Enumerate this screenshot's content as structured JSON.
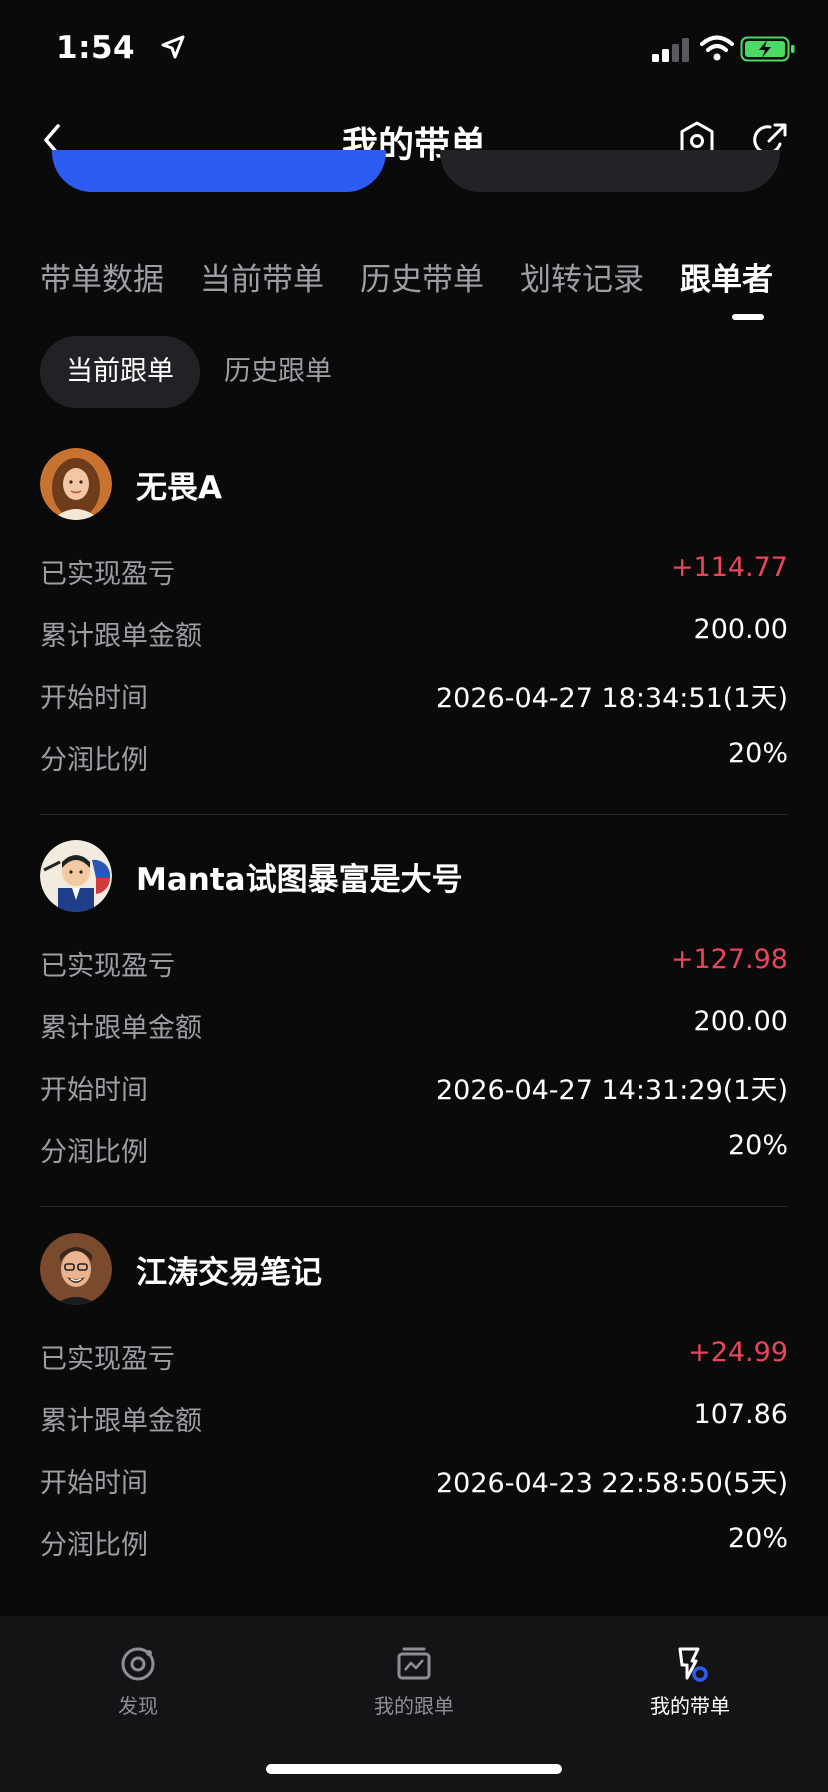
{
  "status_bar": {
    "time": "1:54"
  },
  "header": {
    "title": "我的带单"
  },
  "tabs": [
    {
      "label": "带单数据"
    },
    {
      "label": "当前带单"
    },
    {
      "label": "历史带单"
    },
    {
      "label": "划转记录"
    },
    {
      "label": "跟单者"
    }
  ],
  "subtabs": [
    {
      "label": "当前跟单"
    },
    {
      "label": "历史跟单"
    }
  ],
  "labels": {
    "realized_pnl": "已实现盈亏",
    "total_amount": "累计跟单金额",
    "start_time": "开始时间",
    "profit_share": "分润比例"
  },
  "followers": [
    {
      "name": "无畏A",
      "realized_pnl": "+114.77",
      "total_amount": "200.00",
      "start_time": "2026-04-27 18:34:51(1天)",
      "profit_share": "20%"
    },
    {
      "name": "Manta试图暴富是大号",
      "realized_pnl": "+127.98",
      "total_amount": "200.00",
      "start_time": "2026-04-27 14:31:29(1天)",
      "profit_share": "20%"
    },
    {
      "name": "江涛交易笔记",
      "realized_pnl": "+24.99",
      "total_amount": "107.86",
      "start_time": "2026-04-23 22:58:50(5天)",
      "profit_share": "20%"
    }
  ],
  "bottom_nav": [
    {
      "label": "发现",
      "icon": "discover-icon"
    },
    {
      "label": "我的跟单",
      "icon": "chart-box-icon"
    },
    {
      "label": "我的带单",
      "icon": "copy-trade-icon"
    }
  ],
  "colors": {
    "background": "#0a0a0b",
    "accent_blue": "#2d5cf2",
    "pnl_positive": "#e8465b",
    "muted_text": "#9c9ea4"
  }
}
